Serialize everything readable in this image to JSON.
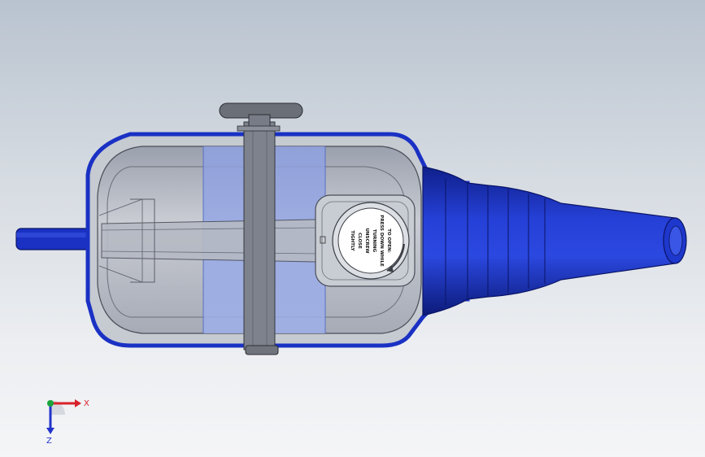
{
  "cap_label": {
    "lines": [
      "TO OPEN:",
      "PRESS DOWN WHILE",
      "TURNING",
      "UNSCREW",
      "CLOSE",
      "TIGHTLY"
    ]
  },
  "triad": {
    "x_label": "X",
    "z_label": "Z"
  },
  "colors": {
    "brand_blue": "#1a31c4",
    "axis_x": "#d8222a",
    "axis_y": "#1aa33a",
    "axis_z": "#2233cc"
  }
}
